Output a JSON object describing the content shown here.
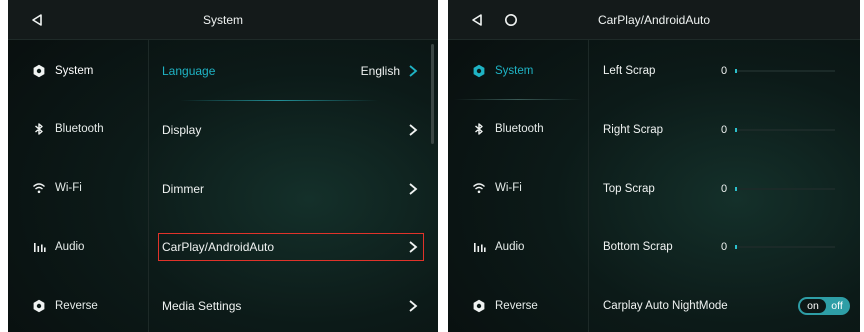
{
  "left_screen": {
    "title": "System",
    "sidebar": [
      {
        "label": "System",
        "icon": "gear-icon",
        "active": true
      },
      {
        "label": "Bluetooth",
        "icon": "bluetooth-icon"
      },
      {
        "label": "Wi-Fi",
        "icon": "wifi-icon"
      },
      {
        "label": "Audio",
        "icon": "audio-bars-icon"
      },
      {
        "label": "Reverse",
        "icon": "gear-icon"
      }
    ],
    "rows": [
      {
        "label": "Language",
        "value": "English"
      },
      {
        "label": "Display"
      },
      {
        "label": "Dimmer"
      },
      {
        "label": "CarPlay/AndroidAuto"
      },
      {
        "label": "Media Settings"
      }
    ]
  },
  "right_screen": {
    "title": "CarPlay/AndroidAuto",
    "sidebar": [
      {
        "label": "System",
        "icon": "gear-icon",
        "active": true
      },
      {
        "label": "Bluetooth",
        "icon": "bluetooth-icon"
      },
      {
        "label": "Wi-Fi",
        "icon": "wifi-icon"
      },
      {
        "label": "Audio",
        "icon": "audio-bars-icon"
      },
      {
        "label": "Reverse",
        "icon": "gear-icon"
      }
    ],
    "sliders": [
      {
        "label": "Left Scrap",
        "value": "0"
      },
      {
        "label": "Right Scrap",
        "value": "0"
      },
      {
        "label": "Top Scrap",
        "value": "0"
      },
      {
        "label": "Bottom Scrap",
        "value": "0"
      }
    ],
    "nightmode": {
      "label": "Carplay Auto NightMode",
      "on": "on",
      "off": "off"
    }
  },
  "colors": {
    "accent": "#1fb3c4",
    "highlight": "#e0332a",
    "toggle": "#2e9ea6"
  }
}
